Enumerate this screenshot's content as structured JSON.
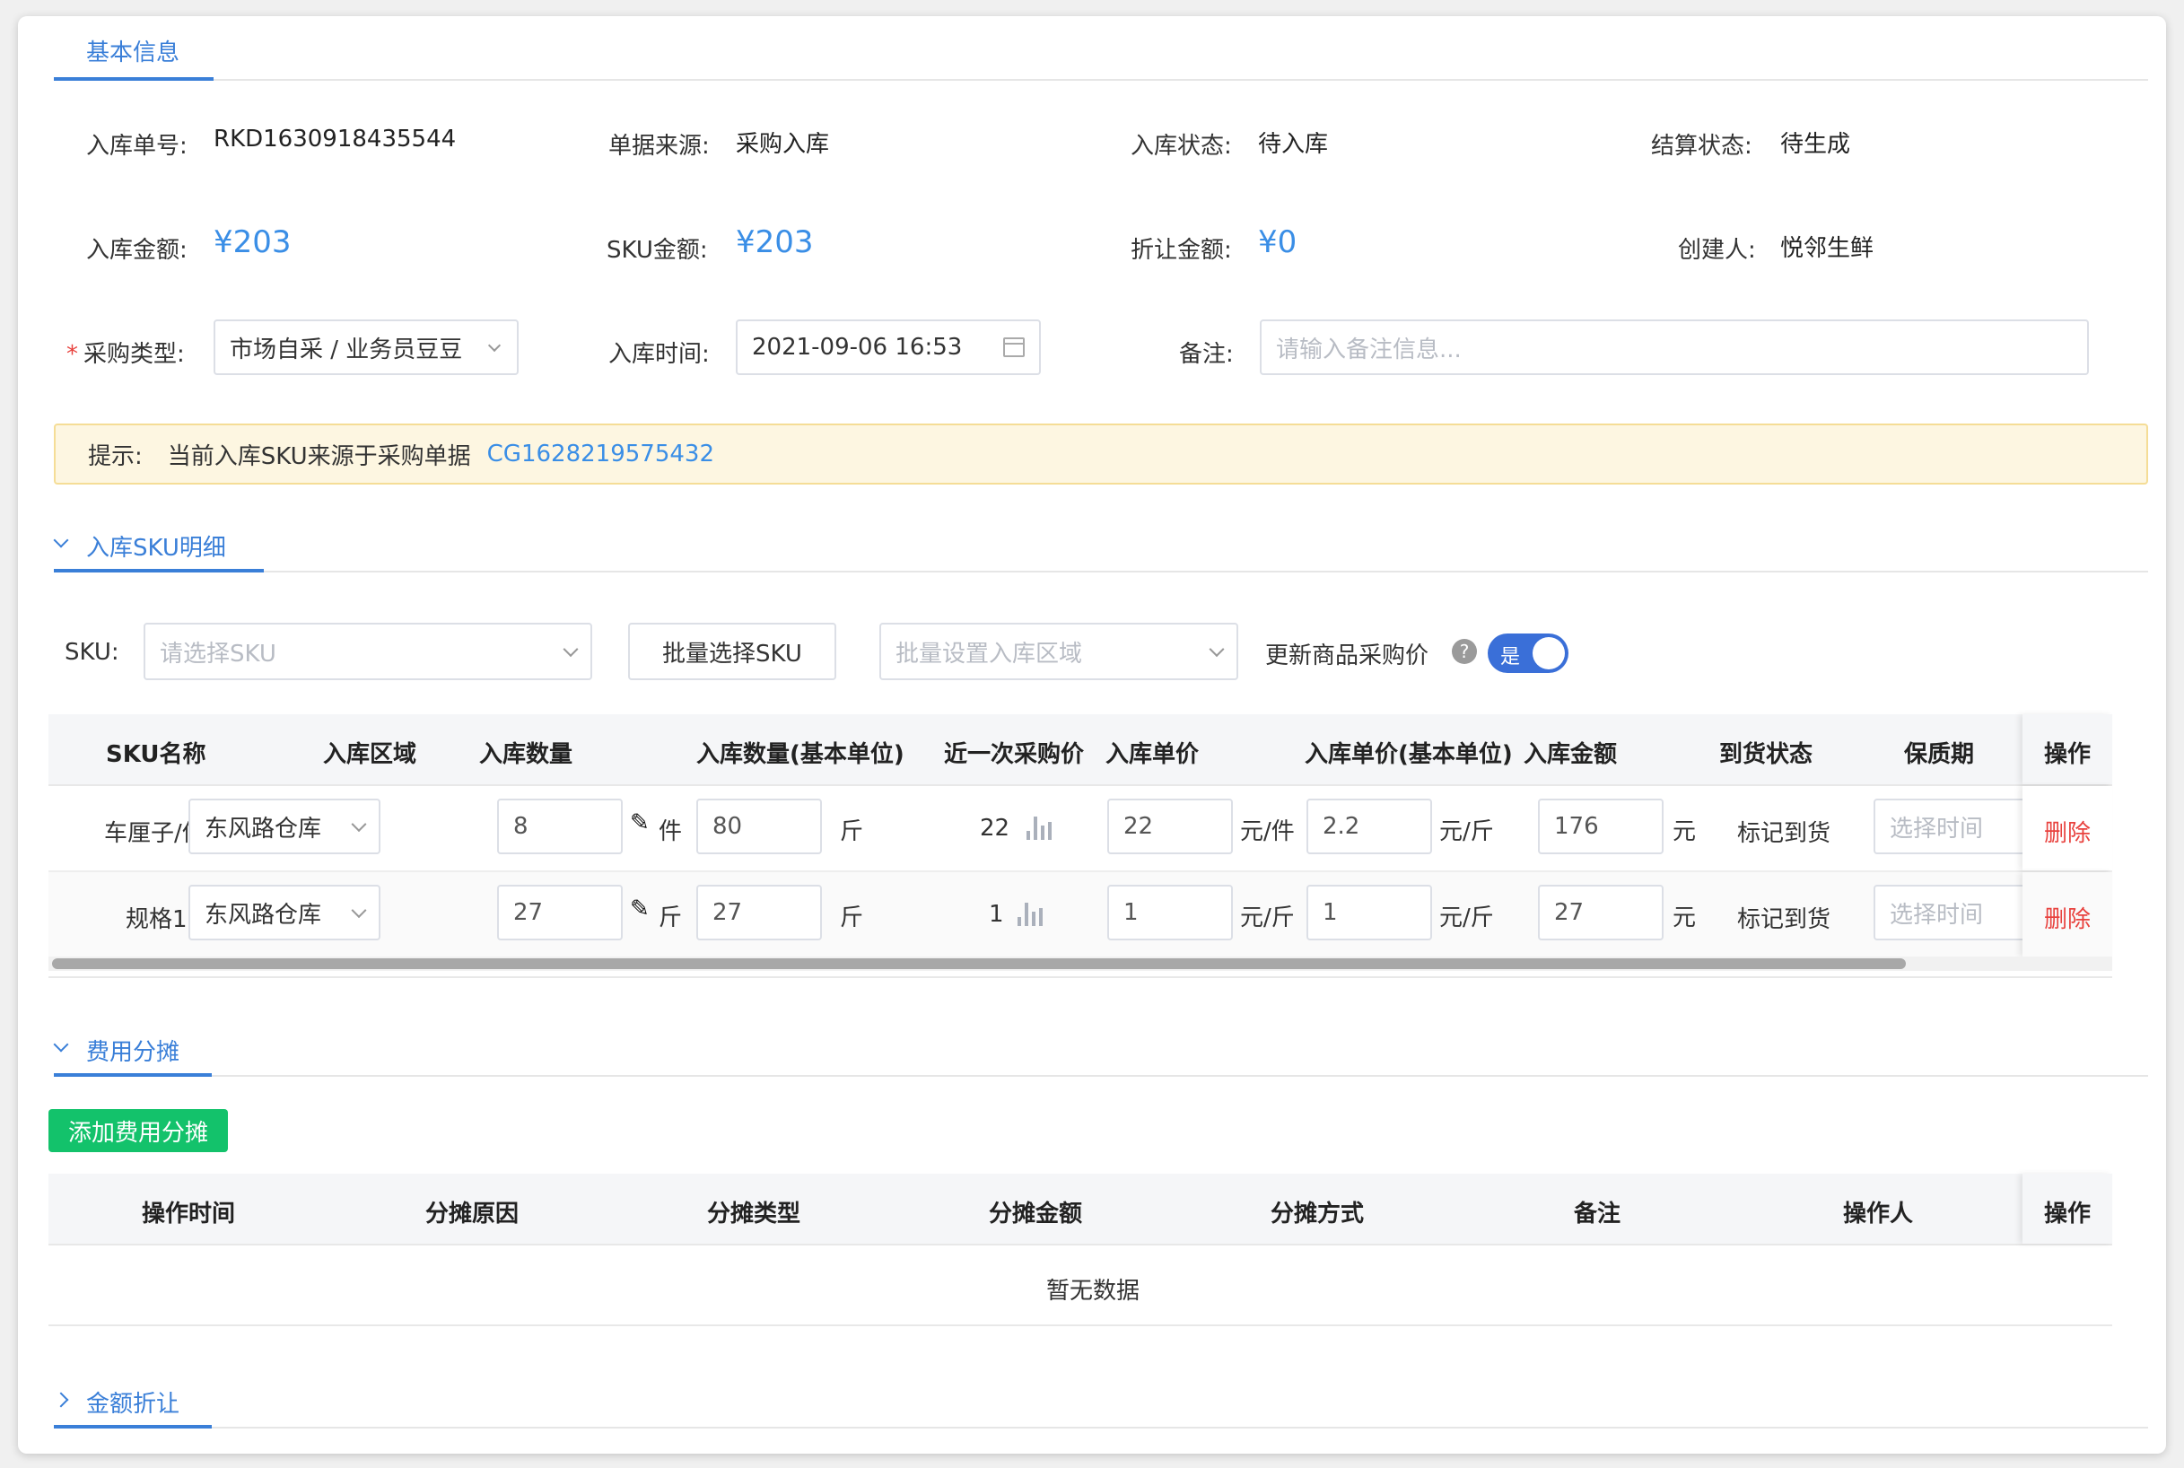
{
  "tabs": {
    "basic_info": "基本信息"
  },
  "info": {
    "order_no_label": "入库单号:",
    "order_no": "RKD1630918435544",
    "source_label": "单据来源:",
    "source": "采购入库",
    "status_label": "入库状态:",
    "status": "待入库",
    "settle_label": "结算状态:",
    "settle": "待生成",
    "amount_label": "入库金额:",
    "amount": "¥203",
    "sku_amount_label": "SKU金额:",
    "sku_amount": "¥203",
    "discount_label": "折让金额:",
    "discount": "¥0",
    "creator_label": "创建人:",
    "creator": "悦邻生鲜",
    "purchase_type_label": "采购类型:",
    "purchase_type": "市场自采 / 业务员豆豆",
    "in_time_label": "入库时间:",
    "in_time": "2021-09-06 16:53",
    "remark_label": "备注:",
    "remark_placeholder": "请输入备注信息..."
  },
  "tip": {
    "prefix": "提示:",
    "text": "当前入库SKU来源于采购单据",
    "link": "CG1628219575432"
  },
  "sku_section": {
    "title": "入库SKU明细",
    "sku_label": "SKU:",
    "sku_placeholder": "请选择SKU",
    "batch_btn": "批量选择SKU",
    "area_placeholder": "批量设置入库区域",
    "update_price_label": "更新商品采购价",
    "help": "?",
    "toggle_text": "是",
    "headers": [
      "SKU名称",
      "入库区域",
      "入库数量",
      "入库数量(基本单位)",
      "近一次采购价",
      "入库单价",
      "入库单价(基本单位)",
      "入库金额",
      "到货状态",
      "保质期",
      "操作"
    ],
    "rows": [
      {
        "name": "车厘子/件",
        "area": "东风路仓库",
        "qty": "8",
        "qty_unit": "件",
        "base_qty": "80",
        "base_unit": "斤",
        "last_price": "22",
        "price": "22",
        "price_unit": "元/件",
        "base_price": "2.2",
        "base_price_unit": "元/斤",
        "amount": "176",
        "amount_unit": "元",
        "arrival": "标记到货",
        "shelf_placeholder": "选择时间",
        "op": "删除"
      },
      {
        "name": "规格1",
        "area": "东风路仓库",
        "qty": "27",
        "qty_unit": "斤",
        "base_qty": "27",
        "base_unit": "斤",
        "last_price": "1",
        "price": "1",
        "price_unit": "元/斤",
        "base_price": "1",
        "base_price_unit": "元/斤",
        "amount": "27",
        "amount_unit": "元",
        "arrival": "标记到货",
        "shelf_placeholder": "选择时间",
        "op": "删除"
      }
    ]
  },
  "cost_section": {
    "title": "费用分摊",
    "add_btn": "添加费用分摊",
    "headers": [
      "操作时间",
      "分摊原因",
      "分摊类型",
      "分摊金额",
      "分摊方式",
      "备注",
      "操作人",
      "操作"
    ],
    "empty": "暂无数据"
  },
  "discount_section": {
    "title": "金额折让"
  },
  "colors": {
    "accent": "#3a7fd8",
    "money": "#3a8ee6",
    "danger": "#e8423e",
    "success": "#13c26b"
  }
}
